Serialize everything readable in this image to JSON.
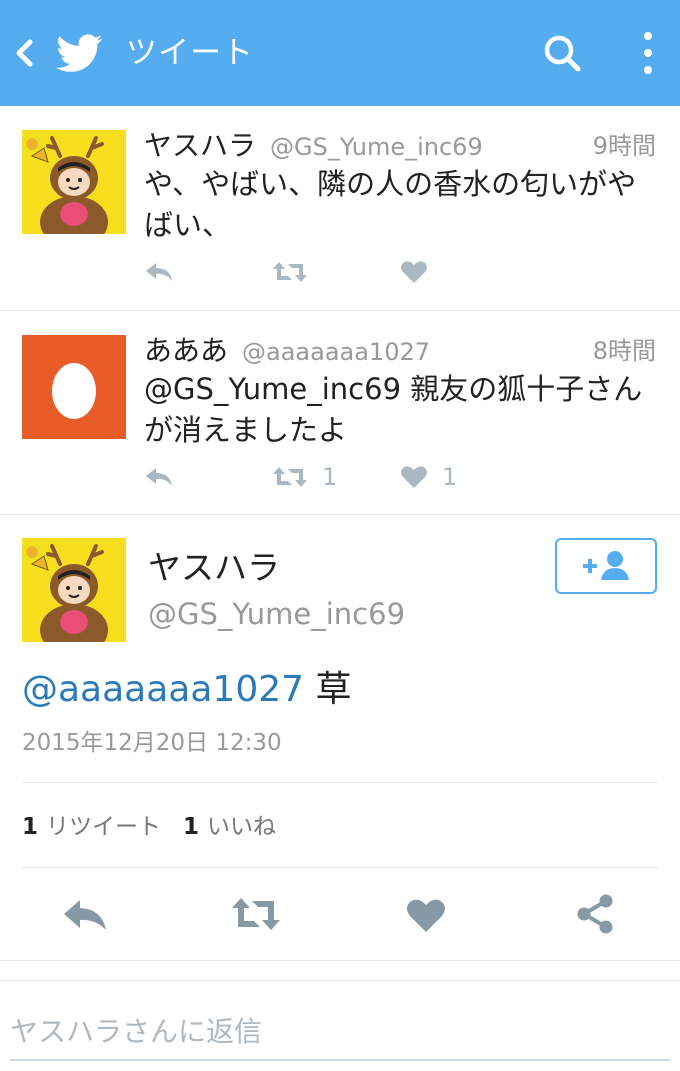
{
  "header": {
    "title": "ツイート",
    "back_icon": "chevron-left-icon",
    "logo_icon": "twitter-bird-icon",
    "search_icon": "search-icon",
    "menu_icon": "more-vertical-icon",
    "color": "#55acee"
  },
  "tweets": [
    {
      "name": "ヤスハラ",
      "handle": "@GS_Yume_inc69",
      "time": "9時間",
      "text": "や、やばい、隣の人の香水の匂いがやばい、",
      "retweets": "",
      "likes": ""
    },
    {
      "name": "あああ",
      "handle": "@aaaaaaa1027",
      "time": "8時間",
      "text": "@GS_Yume_inc69 親友の狐十子さんが消えましたよ",
      "retweets": "1",
      "likes": "1"
    }
  ],
  "detail": {
    "name": "ヤスハラ",
    "handle": "@GS_Yume_inc69",
    "mention": "@aaaaaaa1027",
    "text": " 草",
    "date": "2015年12月20日 12:30",
    "retweet_count": "1",
    "retweet_label": "リツイート",
    "like_count": "1",
    "like_label": "いいね"
  },
  "reply": {
    "placeholder": "ヤスハラさんに返信"
  },
  "colors": {
    "accent": "#55acee",
    "mention": "#2b7bb9",
    "egg_bg": "#e85d27",
    "action_gray": "#aab8c2"
  }
}
